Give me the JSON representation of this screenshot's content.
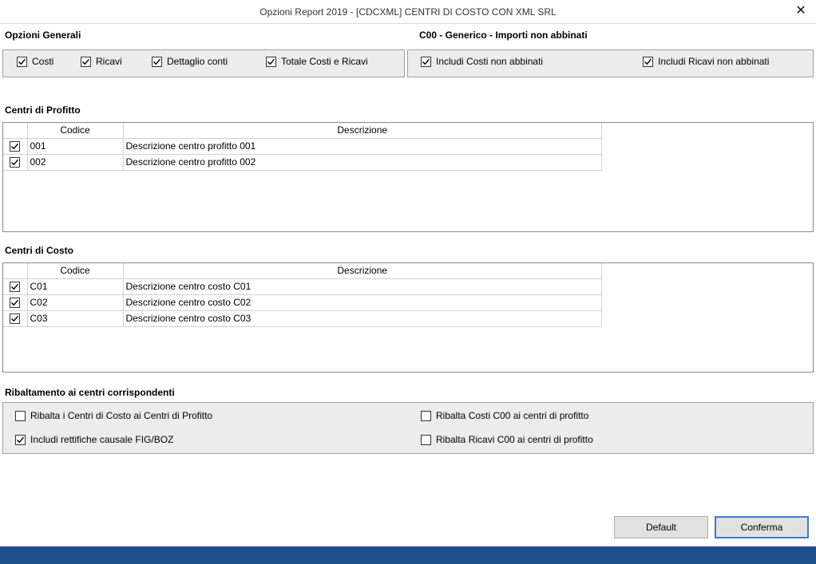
{
  "window": {
    "title": "Opzioni Report 2019 - [CDCXML] CENTRI DI COSTO CON XML SRL",
    "close_glyph": "✕"
  },
  "opzioni_generali": {
    "title": "Opzioni Generali",
    "items": [
      {
        "label": "Costi",
        "checked": true
      },
      {
        "label": "Ricavi",
        "checked": true
      },
      {
        "label": "Dettaglio conti",
        "checked": true
      },
      {
        "label": "Totale Costi e Ricavi",
        "checked": true
      }
    ]
  },
  "c00": {
    "title": "C00 - Generico - Importi non abbinati",
    "items": [
      {
        "label": "Includi Costi non abbinati",
        "checked": true
      },
      {
        "label": "Includi Ricavi non abbinati",
        "checked": true
      }
    ]
  },
  "profitto": {
    "title": "Centri di Profitto",
    "col_codice": "Codice",
    "col_descrizione": "Descrizione",
    "rows": [
      {
        "checked": true,
        "codice": "001",
        "descrizione": "Descrizione centro profitto 001"
      },
      {
        "checked": true,
        "codice": "002",
        "descrizione": "Descrizione centro profitto 002"
      }
    ]
  },
  "costo": {
    "title": "Centri di Costo",
    "col_codice": "Codice",
    "col_descrizione": "Descrizione",
    "rows": [
      {
        "checked": true,
        "codice": "C01",
        "descrizione": "Descrizione centro costo C01"
      },
      {
        "checked": true,
        "codice": "C02",
        "descrizione": "Descrizione centro costo C02"
      },
      {
        "checked": true,
        "codice": "C03",
        "descrizione": "Descrizione centro costo C03"
      }
    ]
  },
  "ribaltamento": {
    "title": "Ribaltamento ai centri corrispondenti",
    "items": [
      {
        "label": "Ribalta i Centri di Costo ai Centri di Profitto",
        "checked": false
      },
      {
        "label": "Ribalta Costi C00 ai centri di profitto",
        "checked": false
      },
      {
        "label": "Includi rettifiche causale FIG/BOZ",
        "checked": true
      },
      {
        "label": "Ribalta Ricavi C00 ai centri di profitto",
        "checked": false
      }
    ]
  },
  "buttons": {
    "default_label": "Default",
    "confirm_label": "Conferma"
  },
  "colors": {
    "footer": "#1f4e8c",
    "group_bg": "#ececec",
    "focus_border": "#3c7bd1"
  }
}
